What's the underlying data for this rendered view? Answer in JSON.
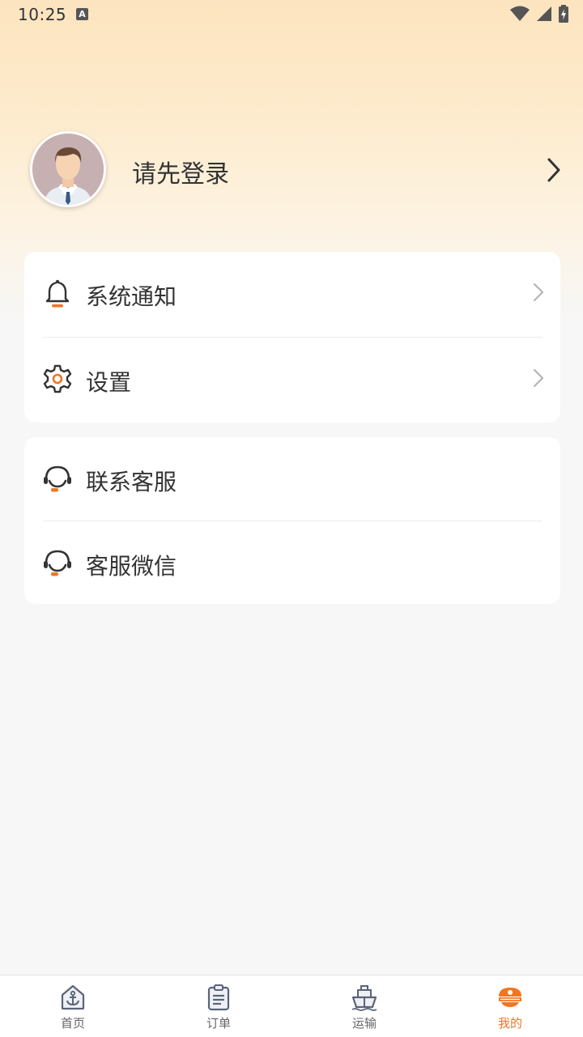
{
  "status_bar": {
    "time": "10:25",
    "notif_letter": "A"
  },
  "profile": {
    "login_prompt": "请先登录"
  },
  "menu_group_1": [
    {
      "label": "系统通知",
      "icon": "bell-icon"
    },
    {
      "label": "设置",
      "icon": "gear-icon"
    }
  ],
  "menu_group_2": [
    {
      "label": "联系客服",
      "icon": "headset-icon"
    },
    {
      "label": "客服微信",
      "icon": "headset-icon"
    }
  ],
  "tabbar": {
    "tabs": [
      {
        "label": "首页",
        "icon": "anchor-home-icon",
        "active": false
      },
      {
        "label": "订单",
        "icon": "clipboard-icon",
        "active": false
      },
      {
        "label": "运输",
        "icon": "ship-icon",
        "active": false
      },
      {
        "label": "我的",
        "icon": "captain-hat-icon",
        "active": true
      }
    ]
  },
  "colors": {
    "accent": "#f07623",
    "text": "#333333",
    "gradient_top": "#fde4bf"
  }
}
